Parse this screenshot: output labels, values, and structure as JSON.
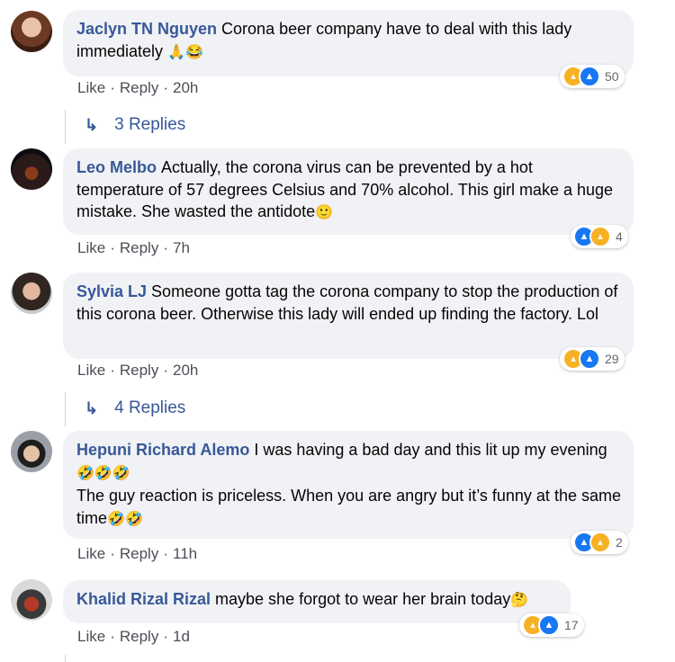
{
  "comments": [
    {
      "author": "Jaclyn TN Nguyen",
      "text": "Corona beer company have to deal with this lady immediately",
      "emoji": "🙏😂",
      "reaction_count": "50",
      "like": "Like",
      "reply": "Reply",
      "time": "20h",
      "replies_label": "3 Replies"
    },
    {
      "author": "Leo Melbo",
      "text": "Actually, the corona virus can be prevented by a hot temperature of 57 degrees Celsius and 70% alcohol. This girl make a huge mistake. She wasted the antidote",
      "emoji": "🙂",
      "reaction_count": "4",
      "like": "Like",
      "reply": "Reply",
      "time": "7h"
    },
    {
      "author": "Sylvia LJ",
      "text": "Someone gotta tag the corona company to stop the production of this corona beer. Otherwise this lady will ended up finding the factory. Lol",
      "reaction_count": "29",
      "like": "Like",
      "reply": "Reply",
      "time": "20h",
      "replies_label": "4 Replies"
    },
    {
      "author": "Hepuni Richard Alemo",
      "text": "I was having a bad day and this lit up my evening",
      "emoji": "🤣🤣🤣",
      "text2": "The guy reaction is priceless. When you are angry but it’s funny at the same time",
      "emoji2": "🤣🤣",
      "reaction_count": "2",
      "like": "Like",
      "reply": "Reply",
      "time": "11h"
    },
    {
      "author": "Khalid Rizal Rizal",
      "text": "maybe she forgot to wear her brain today",
      "emoji": "🤔",
      "reaction_count": "17",
      "like": "Like",
      "reply": "Reply",
      "time": "1d"
    }
  ],
  "colors": {
    "author": "#385898",
    "bubble": "#f0f2f5",
    "like_reaction": "#1877f2",
    "haha_reaction": "#f7b125"
  },
  "icons": {
    "haha": "haha-reaction-icon",
    "like": "like-reaction-icon",
    "reply_arrow": "reply-arrow-icon"
  }
}
